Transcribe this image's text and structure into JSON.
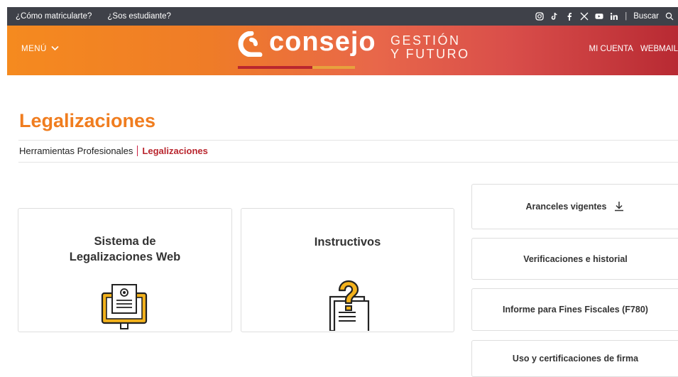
{
  "topbar": {
    "links": [
      "¿Cómo matricularte?",
      "¿Sos estudiante?"
    ],
    "social": [
      "instagram-icon",
      "tiktok-icon",
      "facebook-icon",
      "x-icon",
      "youtube-icon",
      "linkedin-icon"
    ],
    "search_label": "Buscar"
  },
  "header": {
    "menu_label": "MENÚ",
    "logo_word": "consejo",
    "logo_gestion": "GESTIÓN",
    "logo_futuro": "Y FUTURO",
    "account_label": "MI CUENTA",
    "webmail_label": "WEBMAIL"
  },
  "page": {
    "title": "Legalizaciones",
    "breadcrumb": [
      "Herramientas Profesionales",
      "Legalizaciones"
    ]
  },
  "cards": [
    {
      "title_line1": "Sistema de",
      "title_line2": "Legalizaciones Web",
      "icon": "document-monitor-icon"
    },
    {
      "title": "Instructivos",
      "icon": "question-document-icon"
    }
  ],
  "side_buttons": [
    {
      "label": "Aranceles vigentes",
      "icon": "download-icon"
    },
    {
      "label": "Verificaciones e historial"
    },
    {
      "label": "Informe para Fines Fiscales (F780)"
    },
    {
      "label": "Uso y certificaciones de firma"
    }
  ],
  "colors": {
    "accent_orange": "#f07d1f",
    "brand_red": "#b9262e",
    "topbar_bg": "#3f4149",
    "icon_yellow": "#f3b21c"
  }
}
